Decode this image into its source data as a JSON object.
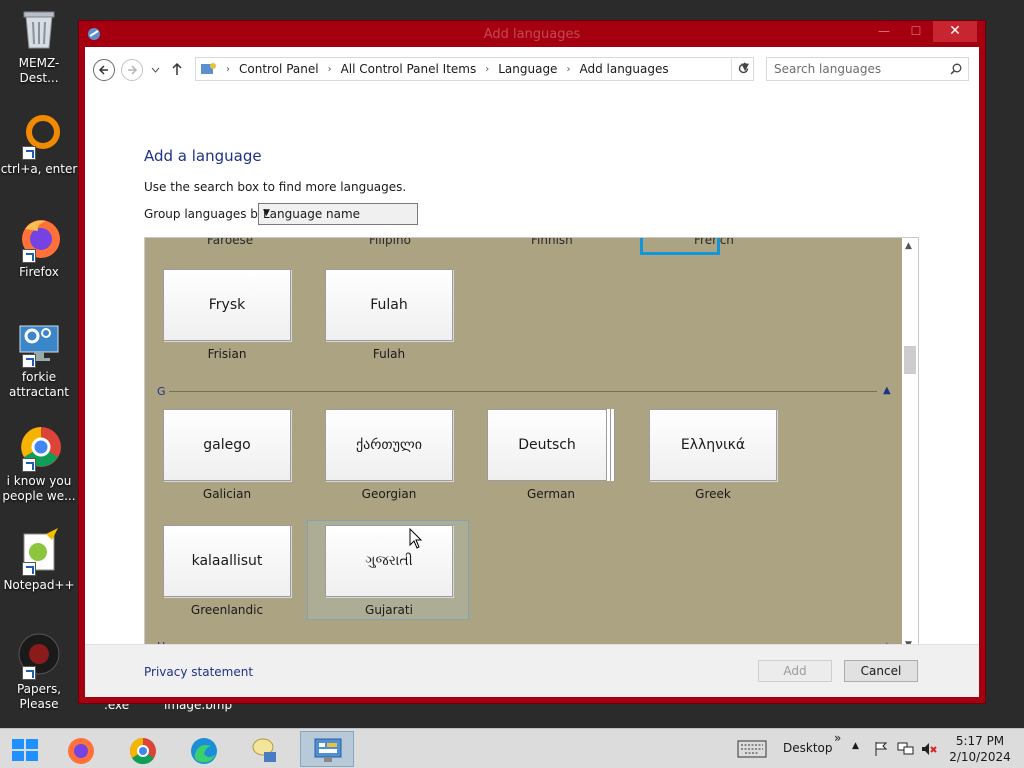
{
  "desktop": {
    "icons": [
      {
        "label": "MEMZ-Dest...",
        "icon": "recycle-bin-icon"
      },
      {
        "label": "ctrl+a, enter",
        "icon": "ring-icon"
      },
      {
        "label": "Firefox",
        "icon": "firefox-icon"
      },
      {
        "label": "forkie attractant",
        "icon": "monitor-gear-icon"
      },
      {
        "label": "i know you people we...",
        "icon": "chrome-icon"
      },
      {
        "label": "Notepad++",
        "icon": "notepad-plus-plus-icon"
      },
      {
        "label": "Papers, Please",
        "icon": "papers-please-icon"
      }
    ],
    "peek_labels": [
      ".exe",
      "image.bmp"
    ]
  },
  "window": {
    "title": "Add languages",
    "close_glyph": "✕",
    "minimize_glyph": "—",
    "maximize_glyph": "☐"
  },
  "address": {
    "crumbs": [
      "Control Panel",
      "All Control Panel Items",
      "Language",
      "Add languages"
    ],
    "search_placeholder": "Search languages"
  },
  "content": {
    "heading": "Add a language",
    "hint": "Use the search box to find more languages.",
    "group_label": "Group languages by:",
    "group_value": "Language name"
  },
  "languages": {
    "partial_row": [
      "Faroese",
      "Filipino",
      "Finnish",
      "French"
    ],
    "rows": [
      {
        "tiles": [
          {
            "native": "Frysk",
            "name": "Frisian"
          },
          {
            "native": "Fulah",
            "name": "Fulah"
          }
        ]
      },
      {
        "tiles": [
          {
            "native": "galego",
            "name": "Galician"
          },
          {
            "native": "ქართული",
            "name": "Georgian"
          },
          {
            "native": "Deutsch",
            "name": "German"
          },
          {
            "native": "Ελληνικά",
            "name": "Greek"
          }
        ]
      },
      {
        "tiles": [
          {
            "native": "kalaallisut",
            "name": "Greenlandic"
          },
          {
            "native": "ગુજરાતી",
            "name": "Gujarati"
          }
        ]
      }
    ],
    "group_g": "G",
    "group_h": "H",
    "selected": "Gujarati"
  },
  "footer": {
    "privacy": "Privacy statement",
    "add": "Add",
    "cancel": "Cancel"
  },
  "taskbar": {
    "items": [
      "start-icon",
      "firefox-icon",
      "chrome-icon",
      "edge-icon",
      "chat-bubble-icon",
      "control-panel-icon"
    ],
    "active_item": "control-panel-icon",
    "desktop_label": "Desktop",
    "overflow": "»",
    "clock_time": "5:17 PM",
    "clock_date": "2/10/2024"
  },
  "colors": {
    "window_frame": "#a50010",
    "tile_area": "#aba382",
    "focus": "#1196d8",
    "heading": "#1e3287"
  }
}
